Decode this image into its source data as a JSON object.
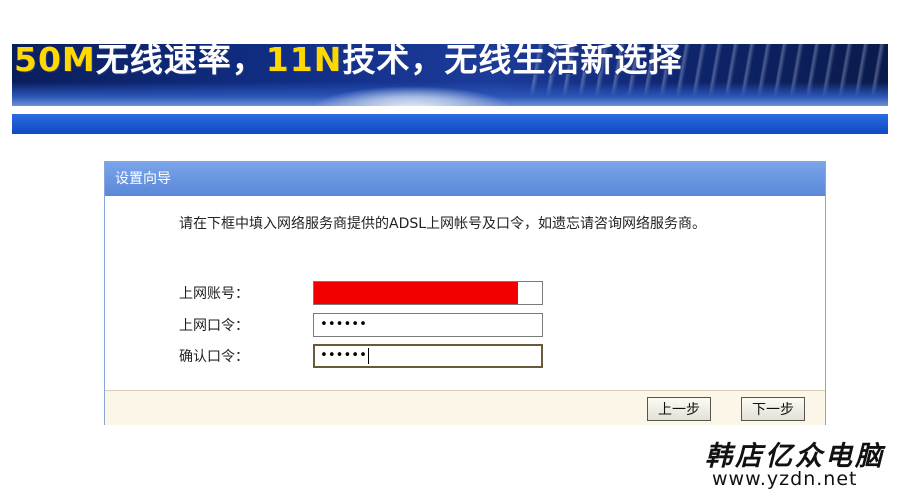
{
  "banner": {
    "slogan_prefix": "50M",
    "slogan_part1": "无线速率，",
    "slogan_highlight": "11N",
    "slogan_part2": "技术，无线生活新选择"
  },
  "wizard": {
    "title": "设置向导",
    "instruction": "请在下框中填入网络服务商提供的ADSL上网帐号及口令，如遗忘请咨询网络服务商。",
    "fields": [
      {
        "label": "上网账号：",
        "value": "",
        "redacted": true
      },
      {
        "label": "上网口令：",
        "value": "••••••"
      },
      {
        "label": "确认口令：",
        "value": "••••••"
      }
    ],
    "buttons": {
      "back": "上一步",
      "next": "下一步"
    }
  },
  "watermark": {
    "brand": "韩店亿众电脑",
    "url": "www.yzdn.net"
  },
  "colors": {
    "redaction": "#f20000",
    "header_blue": "#6a96e0",
    "footer_beige": "#fbf6e8",
    "banner_highlight": "#ffd800"
  }
}
